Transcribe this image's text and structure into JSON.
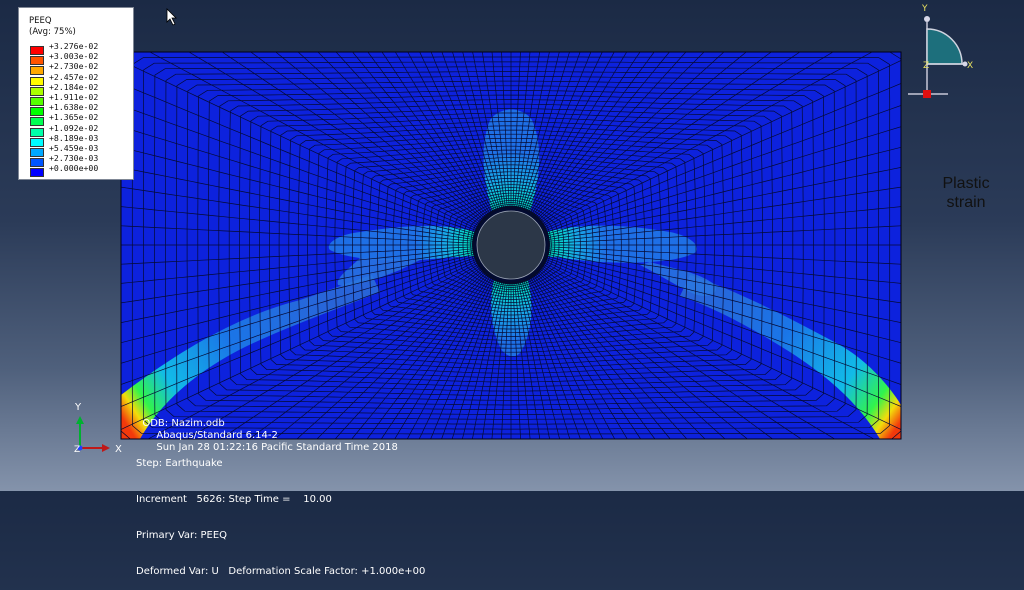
{
  "legend": {
    "title": "PEEQ",
    "subtitle": "(Avg: 75%)",
    "entries": [
      {
        "label": "+3.276e-02",
        "color": "#ff0000"
      },
      {
        "label": "+3.003e-02",
        "color": "#ff5300"
      },
      {
        "label": "+2.730e-02",
        "color": "#ffa800"
      },
      {
        "label": "+2.457e-02",
        "color": "#fffc00"
      },
      {
        "label": "+2.184e-02",
        "color": "#aaff00"
      },
      {
        "label": "+1.911e-02",
        "color": "#55ff00"
      },
      {
        "label": "+1.638e-02",
        "color": "#00ff00"
      },
      {
        "label": "+1.365e-02",
        "color": "#00ff53"
      },
      {
        "label": "+1.092e-02",
        "color": "#00ffa8"
      },
      {
        "label": "+8.189e-03",
        "color": "#00fcff"
      },
      {
        "label": "+5.459e-03",
        "color": "#00a8ff"
      },
      {
        "label": "+2.730e-03",
        "color": "#0055ff"
      },
      {
        "label": "+0.000e+00",
        "color": "#0000ff"
      }
    ]
  },
  "annotation": {
    "line1": "Plastic",
    "line2": "strain"
  },
  "odb_info": {
    "odb": "ODB: Nazim.odb",
    "solver": "Abaqus/Standard 6.14-2",
    "date": "Sun Jan 28 01:22:16 Pacific Standard Time 2018"
  },
  "step_info": {
    "step": "Step: Earthquake",
    "increment": "Increment   5626: Step Time =    10.00",
    "primary_var": "Primary Var: PEEQ",
    "deformed_var": "Deformed Var: U   Deformation Scale Factor: +1.000e+00"
  },
  "triad_axes": {
    "x": "X",
    "y": "Y",
    "z": "Z"
  },
  "view_triad_axes": {
    "x": "X",
    "y": "Y",
    "z": "Z"
  },
  "colors": {
    "mesh_base": "#0d22dd",
    "mesh_line": "#050a33",
    "tunnel_fill": "#2c3748"
  }
}
